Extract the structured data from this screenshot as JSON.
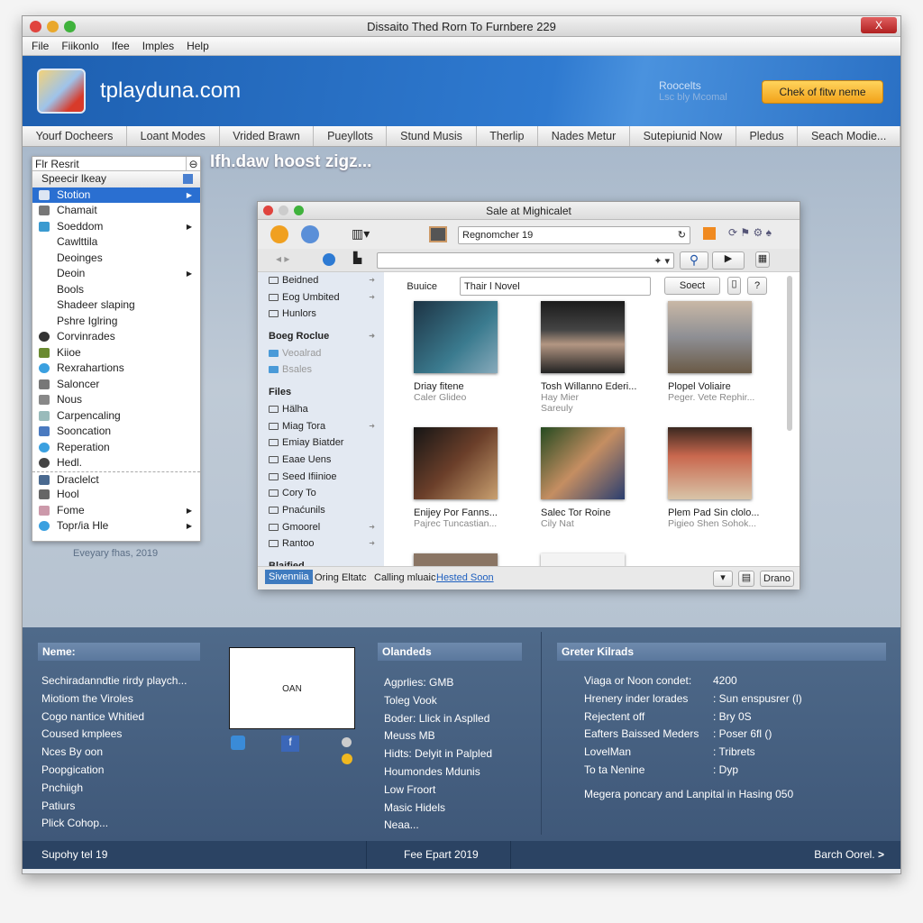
{
  "window": {
    "title": "Dissaito Thed Rorn To Furnbere 229",
    "close": "X"
  },
  "menu": [
    "File",
    "Fiikonlo",
    "Ifee",
    "Imples",
    "Help"
  ],
  "header": {
    "site": "tplayduna.com",
    "right_title": "Roocelts",
    "right_sub": "Lsc bly Mcomal",
    "cta": "Chek of fitw neme",
    "brand": "#2a6fc4",
    "cta_color": "#f5b030"
  },
  "nav": [
    "Yourf Docheers",
    "Loant Modes",
    "Vrided Brawn",
    "Pueyllots",
    "Stund Musis",
    "Therlip",
    "Nades Metur",
    "Sutepiunid Now",
    "Pledus",
    "Seach Modie..."
  ],
  "main": {
    "heading": "Ifh.daw hoost zigz..."
  },
  "left_menu": {
    "search": "Flr Resrit",
    "items": [
      {
        "label": "Speecir lkeay",
        "icon": "info-icon",
        "arrow": false
      },
      {
        "label": "Stotion",
        "icon": "window-icon",
        "arrow": true,
        "selected": true
      },
      {
        "label": "Chamait",
        "icon": "printer-icon",
        "arrow": false
      },
      {
        "label": "Soeddom",
        "icon": "sailboat-icon",
        "arrow": true
      },
      {
        "label": "Cawlttila",
        "icon": "",
        "arrow": false
      },
      {
        "label": "Deoinges",
        "icon": "",
        "arrow": false
      },
      {
        "label": "Deoin",
        "icon": "",
        "arrow": true
      },
      {
        "label": "Bools",
        "icon": "",
        "arrow": false
      },
      {
        "label": "Shadeer slaping",
        "icon": "",
        "arrow": false
      },
      {
        "label": "Pshre Iglring",
        "icon": "",
        "arrow": false
      },
      {
        "label": "Corvinrades",
        "icon": "person-icon",
        "arrow": false
      },
      {
        "label": "Kiioe",
        "icon": "trophy-icon",
        "arrow": false
      },
      {
        "label": "Rexrahartions",
        "icon": "globe-icon",
        "arrow": false
      },
      {
        "label": "Saloncer",
        "icon": "printer-icon",
        "arrow": false
      },
      {
        "label": "Nous",
        "icon": "document-icon",
        "arrow": false
      },
      {
        "label": "Carpencaling",
        "icon": "monitor-icon",
        "arrow": false
      },
      {
        "label": "Sooncation",
        "icon": "keyboard-icon",
        "arrow": false
      },
      {
        "label": "Reperation",
        "icon": "globe-icon",
        "arrow": false
      },
      {
        "label": "Hedl.",
        "icon": "disc-icon",
        "arrow": false
      },
      {
        "label": "Draclelct",
        "icon": "folder-icon",
        "arrow": false
      },
      {
        "label": "Hool",
        "icon": "image-icon",
        "arrow": false
      },
      {
        "label": "Fome",
        "icon": "home-icon",
        "arrow": true
      },
      {
        "label": "Topr/ia Hle",
        "icon": "globe-icon",
        "arrow": true
      }
    ],
    "caption": "Eveyary fhas, 2019"
  },
  "inner": {
    "title": "Sale at Mighicalet",
    "address": "Regnomcher 19",
    "search_label": "Buuice",
    "search_value": "Thair l Novel",
    "select_btn": "Soect",
    "help_btn": "?",
    "sidebar": [
      {
        "label": "Beidned",
        "type": "folder",
        "arrow": true
      },
      {
        "label": "Eog Umbited",
        "type": "folder",
        "arrow": true
      },
      {
        "label": "Hunlors",
        "type": "folder",
        "arrow": false
      },
      {
        "label": "Boeg Roclue",
        "type": "header",
        "arrow": true
      },
      {
        "label": "Veoalrad",
        "type": "grey",
        "arrow": false
      },
      {
        "label": "Bsales",
        "type": "grey",
        "arrow": false
      },
      {
        "label": "Files",
        "type": "header",
        "arrow": false
      },
      {
        "label": "Hälha",
        "type": "folder",
        "arrow": false
      },
      {
        "label": "Miag Tora",
        "type": "folder",
        "arrow": true
      },
      {
        "label": "Emiay Biatder",
        "type": "folder",
        "arrow": false
      },
      {
        "label": "Eaae Uens",
        "type": "folder",
        "arrow": false
      },
      {
        "label": "Seed Ifiinioe",
        "type": "folder",
        "arrow": false
      },
      {
        "label": "Cory To",
        "type": "folder",
        "arrow": false
      },
      {
        "label": "Pnaćunils",
        "type": "folder",
        "arrow": false
      },
      {
        "label": "Gmoorel",
        "type": "folder",
        "arrow": true
      },
      {
        "label": "Rantoo",
        "type": "folder",
        "arrow": true
      },
      {
        "label": "Blaified",
        "type": "header",
        "arrow": false
      }
    ],
    "cards": [
      {
        "title": "Driay fitene",
        "sub": "Caler Glideo",
        "sub2": ""
      },
      {
        "title": "Tosh Willanno Ederi...",
        "sub": "Hay Mier",
        "sub2": "Sareuly"
      },
      {
        "title": "Plopel Voliaire",
        "sub": "Peger. Vete Rephir...",
        "sub2": ""
      },
      {
        "title": "Enijey Por Fanns...",
        "sub": "Pajrec Tuncastian...",
        "sub2": ""
      },
      {
        "title": "Salec Tor Roine",
        "sub": "Cily Nat",
        "sub2": ""
      },
      {
        "title": "Plem Pad Sin clolo...",
        "sub": "Pigieo Shen Sohok...",
        "sub2": ""
      }
    ],
    "status": {
      "tag": "Sivenniia",
      "t1": "Oring Eltatc",
      "t2": "Calling mluaic",
      "link": "Hested Soon",
      "right_btn": "Drano"
    }
  },
  "bottom": {
    "col1": {
      "header": "Neme:",
      "items": [
        "Sechiradanndtie rirdy playch...",
        "Miotiom the Viroles",
        "Cogo nantice Whitied",
        "Coused kmplees",
        "Nces By oon",
        "Poopgication",
        "Pnchiigh",
        "Patiurs",
        "Plick Cohop..."
      ]
    },
    "box_text": "OAN",
    "col2": {
      "header": "Olandeds",
      "items": [
        "Agprlies: GMB",
        "Toleg Vook",
        "Boder: Llick in Asplled",
        "Meuss MB",
        "Hidts: Delyit in Palpled",
        "Houmondes Mdunis",
        "Low Froort",
        "Masic Hidels",
        "Neaa..."
      ]
    },
    "col3": {
      "header": "Greter Kilrads",
      "rows": [
        {
          "k": "Viaga or Noon condet:",
          "v": "4200"
        },
        {
          "k": "Hrenery inder lorades",
          "v": ": Sun enspusrer (l)"
        },
        {
          "k": "Rejectent off",
          "v": ": Bry 0S"
        },
        {
          "k": "Eafters Baissed Meders",
          "v": ": Poser 6fl ()"
        },
        {
          "k": "LovelMan",
          "v": ": Tribrets"
        },
        {
          "k": "To ta Nenine",
          "v": ": Dyp"
        }
      ],
      "note": "Megera poncary and Lanpital in Hasing 050"
    }
  },
  "footer": {
    "left": "Supohy tel 19",
    "center": "Fee Epart 2019",
    "right": "Barch Oorel."
  }
}
